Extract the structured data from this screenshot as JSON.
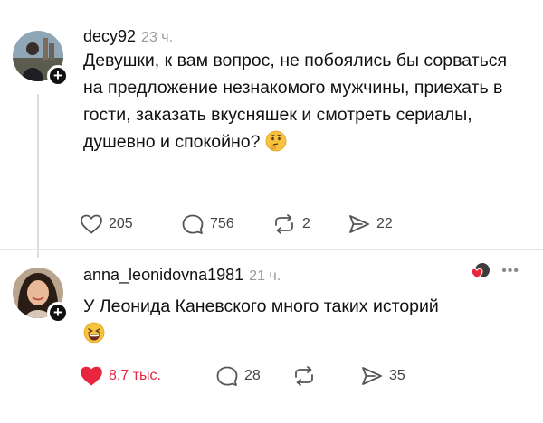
{
  "posts": [
    {
      "username": "decy92",
      "time": "23 ч.",
      "text": "Девушки, к вам вопрос, не побоялись бы сорваться на предложение незнакомого мужчины, приехать в гости, заказать вкусняшек и смотреть сериалы, душевно и спокойно?",
      "emoji": "thinking-face-emoji",
      "likes": "205",
      "comments": "756",
      "reposts": "2",
      "shares": "22",
      "liked": false
    },
    {
      "username": "anna_leonidovna1981",
      "time": "21 ч.",
      "text": "У Леонида Каневского много таких историй",
      "emoji": "grinning-squinting-face-emoji",
      "likes": "8,7 тыс.",
      "comments": "28",
      "reposts": "",
      "shares": "35",
      "liked": true
    }
  ],
  "colors": {
    "like_active": "#e8253f",
    "icon": "#555555",
    "muted": "#9a9a9a"
  }
}
